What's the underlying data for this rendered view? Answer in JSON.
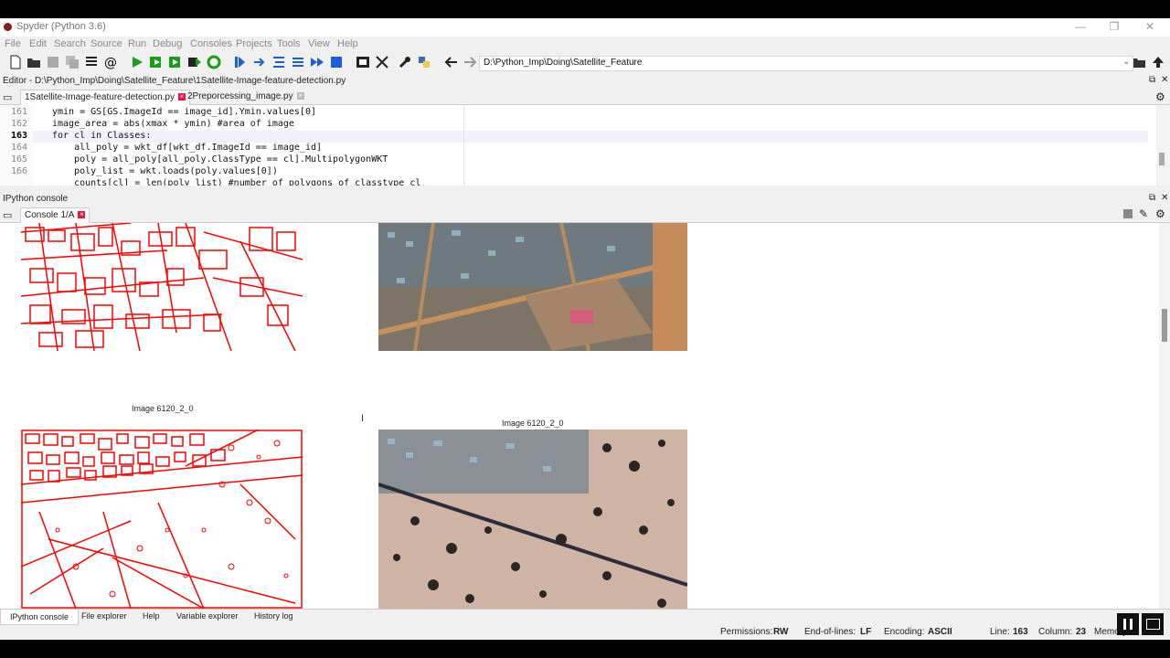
{
  "window": {
    "title": "Spyder (Python 3.6)"
  },
  "menu": [
    "File",
    "Edit",
    "Search",
    "Source",
    "Run",
    "Debug",
    "Consoles",
    "Projects",
    "Tools",
    "View",
    "Help"
  ],
  "toolbar": {
    "path": "D:\\Python_Imp\\Doing\\Satellite_Feature"
  },
  "editor": {
    "header": "Editor - D:\\Python_Imp\\Doing\\Satellite_Feature\\1Satellite-Image-feature-detection.py",
    "tabs": [
      "1Satellite-Image-feature-detection.py",
      "2Preporcessing_image.py"
    ],
    "lines": [
      {
        "num": "161",
        "code": "ymin = GS[GS.ImageId == image_id].Ymin.values[0]"
      },
      {
        "num": "162",
        "code": "image_area = abs(xmax * ymin) #area of image"
      },
      {
        "num": "163",
        "code": "for cl in Classes:"
      },
      {
        "num": "164",
        "code": "    all_poly = wkt_df[wkt_df.ImageId == image_id]"
      },
      {
        "num": "165",
        "code": "    poly = all_poly[all_poly.ClassType == cl].MultipolygonWKT"
      },
      {
        "num": "166",
        "code": "    poly_list = wkt.loads(poly.values[0])"
      },
      {
        "num": "",
        "code": "    counts[cl] = len(poly_list) #number of polygons of classtype cl"
      }
    ]
  },
  "console": {
    "header": "IPython console",
    "tab": "Console 1/A",
    "label_left": "Image 6120_2_0",
    "label_right": "Image 6120_2_0"
  },
  "bottom_tabs": [
    "IPython console",
    "File explorer",
    "Help",
    "Variable explorer",
    "History log"
  ],
  "status": {
    "permissions_label": "Permissions:",
    "permissions": "RW",
    "eol_label": "End-of-lines:",
    "eol": "LF",
    "encoding_label": "Encoding:",
    "encoding": "ASCII",
    "line_label": "Line:",
    "line": "163",
    "column_label": "Column:",
    "column": "23",
    "memory_label": "Memory"
  },
  "colors": {
    "mask_red": "#ff0000",
    "run_green": "#1a9e1a",
    "stop_blue": "#1a5fd6"
  }
}
